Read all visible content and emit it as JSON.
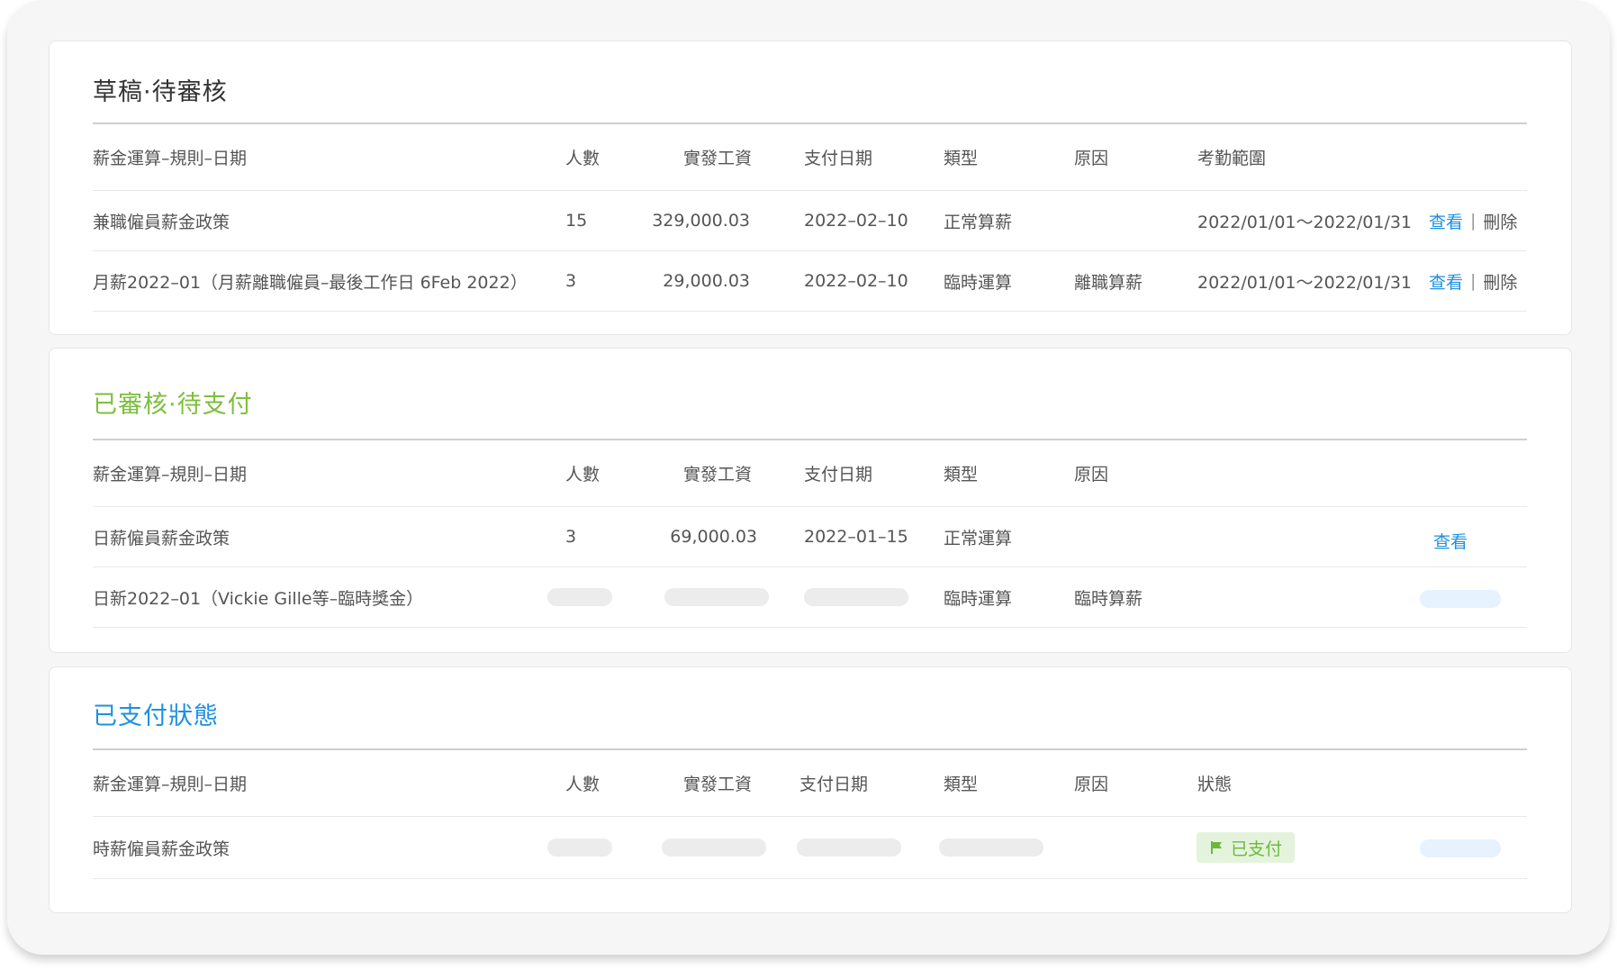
{
  "colors": {
    "draft_title": "#333333",
    "approved_title": "#7cbf3e",
    "paid_title": "#1e90e0",
    "link": "#1e90e0",
    "badge_bg": "#e4f3dc",
    "badge_text": "#6cb83b"
  },
  "draft": {
    "title": "草稿·待審核",
    "headers": {
      "name": "薪金運算–規則–日期",
      "count": "人數",
      "pay": "實發工資",
      "date": "支付日期",
      "type": "類型",
      "reason": "原因",
      "range": "考勤範圍"
    },
    "rows": [
      {
        "name": "兼職僱員薪金政策",
        "count": "15",
        "pay": "329,000.03",
        "date": "2022–02–10",
        "type": "正常算薪",
        "reason": "",
        "range": "2022/01/01～2022/01/31",
        "view": "查看",
        "separator": "|",
        "delete": "刪除"
      },
      {
        "name": "月薪2022–01（月薪離職僱員–最後工作日 6Feb 2022）",
        "count": "3",
        "pay": "29,000.03",
        "date": "2022–02–10",
        "type": "臨時運算",
        "reason": "離職算薪",
        "range": "2022/01/01～2022/01/31",
        "view": "查看",
        "separator": "|",
        "delete": "刪除"
      }
    ]
  },
  "approved": {
    "title": "已審核·待支付",
    "headers": {
      "name": "薪金運算–規則–日期",
      "count": "人數",
      "pay": "實發工資",
      "date": "支付日期",
      "type": "類型",
      "reason": "原因"
    },
    "rows": [
      {
        "name": "日薪僱員薪金政策",
        "count": "3",
        "pay": "69,000.03",
        "date": "2022–01–15",
        "type": "正常運算",
        "reason": "",
        "view": "查看"
      },
      {
        "name": "日新2022–01（Vickie Gille等–臨時獎金）",
        "type": "臨時運算",
        "reason": "臨時算薪"
      }
    ]
  },
  "paid": {
    "title": "已支付狀態",
    "headers": {
      "name": "薪金運算–規則–日期",
      "count": "人數",
      "pay": "實發工資",
      "date": "支付日期",
      "type": "類型",
      "reason": "原因",
      "status": "狀態"
    },
    "rows": [
      {
        "name": "時薪僱員薪金政策",
        "status": "已支付",
        "status_icon": "flag-icon"
      }
    ]
  }
}
